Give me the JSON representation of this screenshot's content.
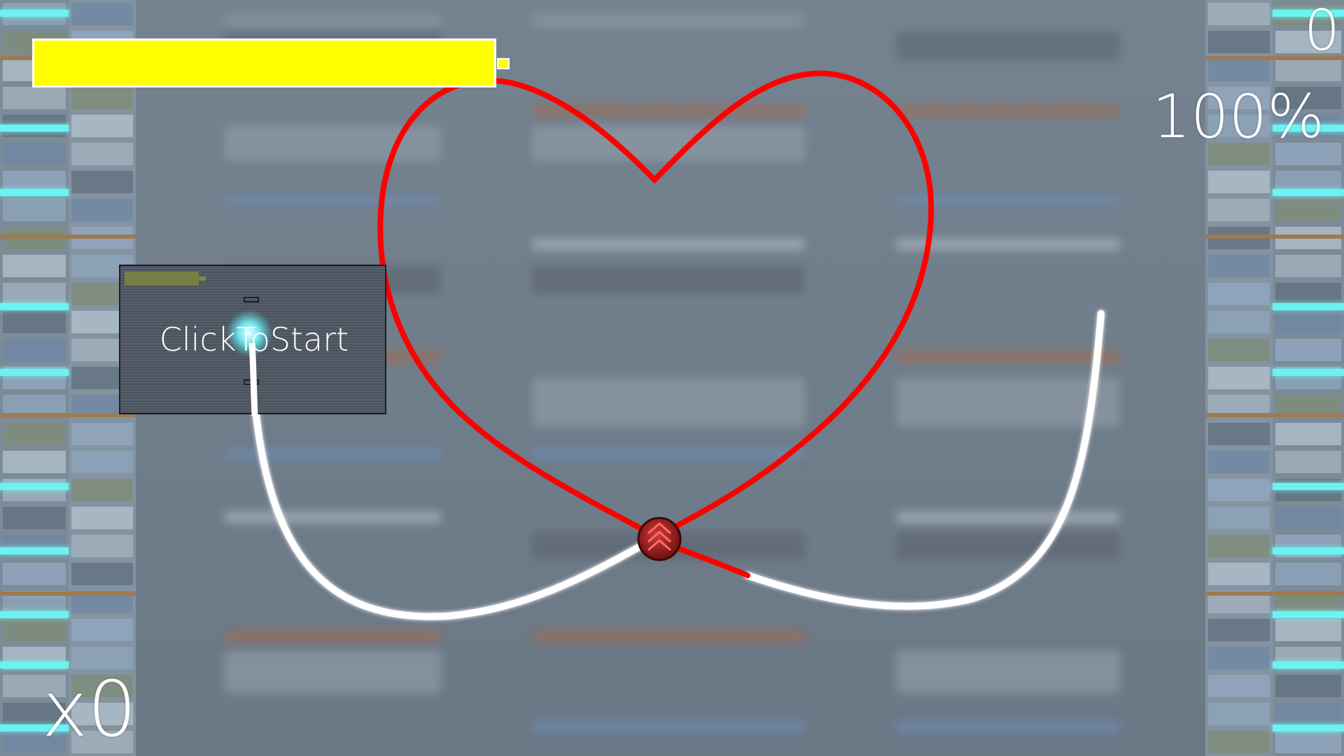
{
  "hud": {
    "score": "0",
    "accuracy": "100%",
    "combo": "x0",
    "health_fraction": 1.0
  },
  "start_panel": {
    "label": "ClickToStart"
  },
  "colors": {
    "health": "#ffff00",
    "heart_path": "#ff0000",
    "rail_path": "#ffffff",
    "side_lights": "#6cf2f0",
    "player_orb": "#b22020"
  },
  "icons": {
    "player": "chevron-up-triple-icon",
    "cursor": "cyan-glow-cursor-icon"
  }
}
